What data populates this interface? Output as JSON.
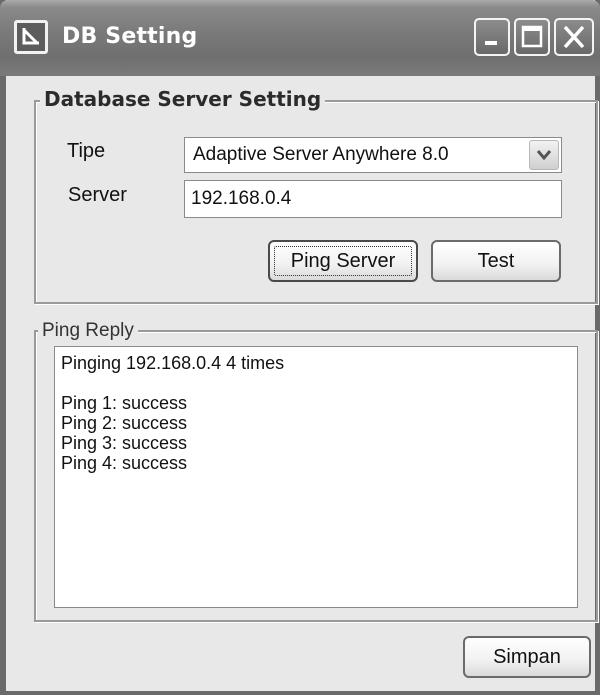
{
  "window": {
    "title": "DB Setting"
  },
  "server_group": {
    "title": "Database Server Setting",
    "tipe_label": "Tipe",
    "tipe_value": "Adaptive Server Anywhere 8.0",
    "server_label": "Server",
    "server_value": "192.168.0.4",
    "ping_button": "Ping Server",
    "test_button": "Test"
  },
  "ping_group": {
    "title": "Ping Reply",
    "lines": [
      "Pinging 192.168.0.4 4 times",
      "",
      "Ping 1: success",
      "Ping 2: success",
      "Ping 3: success",
      "Ping 4: success"
    ]
  },
  "footer": {
    "save_button": "Simpan"
  },
  "icons": {
    "app": "arrow-down-right-icon",
    "minimize": "minimize-icon",
    "maximize": "maximize-icon",
    "close": "close-icon",
    "dropdown": "chevron-down-icon"
  }
}
